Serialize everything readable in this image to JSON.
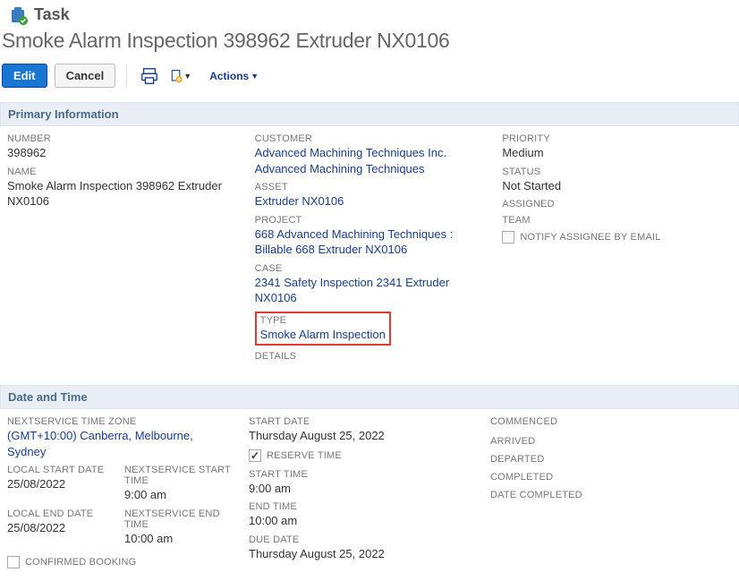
{
  "header": {
    "pageType": "Task",
    "title": "Smoke Alarm Inspection 398962 Extruder NX0106"
  },
  "toolbar": {
    "edit": "Edit",
    "cancel": "Cancel",
    "actions": "Actions"
  },
  "sections": {
    "primary": {
      "title": "Primary Information"
    },
    "datetime": {
      "title": "Date and Time"
    }
  },
  "primary": {
    "number": {
      "label": "NUMBER",
      "value": "398962"
    },
    "name": {
      "label": "NAME",
      "value": "Smoke Alarm Inspection 398962 Extruder NX0106"
    },
    "customer": {
      "label": "CUSTOMER",
      "value": "Advanced Machining Techniques Inc. Advanced Machining Techniques"
    },
    "asset": {
      "label": "ASSET",
      "value": "Extruder NX0106"
    },
    "project": {
      "label": "PROJECT",
      "value": "668 Advanced Machining Techniques : Billable 668 Extruder NX0106"
    },
    "case": {
      "label": "CASE",
      "value": "2341 Safety Inspection 2341 Extruder NX0106"
    },
    "type": {
      "label": "TYPE",
      "value": "Smoke Alarm Inspection"
    },
    "details": {
      "label": "DETAILS",
      "value": ""
    },
    "priority": {
      "label": "PRIORITY",
      "value": "Medium"
    },
    "status": {
      "label": "STATUS",
      "value": "Not Started"
    },
    "assigned": {
      "label": "ASSIGNED",
      "value": ""
    },
    "team": {
      "label": "TEAM",
      "value": ""
    },
    "notifyAssignee": {
      "label": "NOTIFY ASSIGNEE BY EMAIL"
    }
  },
  "datetime": {
    "timezone": {
      "label": "NEXTSERVICE TIME ZONE",
      "value": "(GMT+10:00) Canberra, Melbourne, Sydney"
    },
    "localStartDate": {
      "label": "LOCAL START DATE",
      "value": "25/08/2022"
    },
    "nsStartTime": {
      "label": "NEXTSERVICE START TIME",
      "value": "9:00 am"
    },
    "localEndDate": {
      "label": "LOCAL END DATE",
      "value": "25/08/2022"
    },
    "nsEndTime": {
      "label": "NEXTSERVICE END TIME",
      "value": "10:00 am"
    },
    "confirmedBooking": {
      "label": "CONFIRMED BOOKING"
    },
    "startDate": {
      "label": "START DATE",
      "value": "Thursday August 25, 2022"
    },
    "reserveTime": {
      "label": "RESERVE TIME"
    },
    "startTime": {
      "label": "START TIME",
      "value": "9:00 am"
    },
    "endTime": {
      "label": "END TIME",
      "value": "10:00 am"
    },
    "dueDate": {
      "label": "DUE DATE",
      "value": "Thursday August 25, 2022"
    },
    "commenced": {
      "label": "COMMENCED",
      "value": ""
    },
    "arrived": {
      "label": "ARRIVED",
      "value": ""
    },
    "departed": {
      "label": "DEPARTED",
      "value": ""
    },
    "completed": {
      "label": "COMPLETED",
      "value": ""
    },
    "dateCompleted": {
      "label": "DATE COMPLETED",
      "value": ""
    }
  }
}
